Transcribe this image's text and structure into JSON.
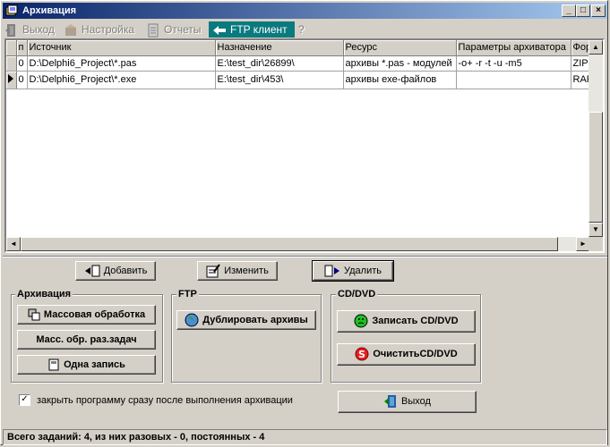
{
  "window": {
    "title": "Архивация"
  },
  "menu": {
    "exit": "Выход",
    "settings": "Настройка",
    "reports": "Отчеты",
    "ftp_client": "FTP клиент",
    "help": "?"
  },
  "grid": {
    "columns": [
      "п",
      "Источник",
      "Назначение",
      "Ресурс",
      "Параметры архиватора",
      "Фор"
    ],
    "rows": [
      {
        "n": "0",
        "source": "D:\\Delphi6_Project\\*.pas",
        "dest": "E:\\test_dir\\26899\\",
        "resource": "архивы *.pas - модулей",
        "params": "-o+ -r -t -u -m5",
        "format": "ZIP",
        "current": false
      },
      {
        "n": "0",
        "source": "D:\\Delphi6_Project\\*.exe",
        "dest": "E:\\test_dir\\453\\",
        "resource": "архивы exe-файлов",
        "params": "",
        "format": "RAR",
        "current": true
      }
    ]
  },
  "actions": {
    "add": "Добавить",
    "edit": "Изменить",
    "delete": "Удалить"
  },
  "groups": {
    "archive": {
      "title": "Архивация",
      "mass": "Массовая обработка",
      "mass_single": "Масс. обр. раз.задач",
      "single": "Одна запись"
    },
    "ftp": {
      "title": "FTP",
      "duplicate": "Дублировать архивы"
    },
    "cd": {
      "title": "CD/DVD",
      "write": "Записать CD/DVD",
      "clear": "ОчиститьCD/DVD"
    }
  },
  "options": {
    "close_after": "закрыть программу сразу после выполнения архивации",
    "close_after_checked": true
  },
  "exit_button": "Выход",
  "status": "Всего заданий: 4, из них разовых - 0, постоянных - 4",
  "colors": {
    "titlebar_start": "#0a246a",
    "titlebar_end": "#a6caf0",
    "menu_active": "#0a7a7e",
    "face": "#d4d0c8"
  }
}
